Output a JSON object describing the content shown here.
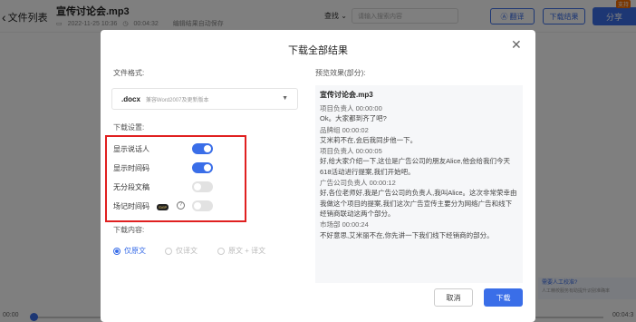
{
  "header": {
    "back_label": "文件列表",
    "file_title": "宣传讨论会.mp3",
    "date": "2022-11-25 10:36",
    "duration": "00:04:32",
    "autosave": "编辑结果自动保存",
    "find_label": "查找",
    "search_placeholder": "请输入搜索内容",
    "translate_label": "翻译",
    "download_result_label": "下载结果",
    "share_label": "分享",
    "share_badge": "支持"
  },
  "player": {
    "time_left": "00:00",
    "time_right": "00:04:3",
    "progress": 0
  },
  "side_tip": {
    "title": "需要人工校准?",
    "sub": "人工精校服务有助提升识别准确率"
  },
  "modal": {
    "title": "下载全部结果",
    "format_label": "文件格式:",
    "format_value": ".docx",
    "format_hint": "兼容Word2007及更新版本",
    "settings_label": "下载设置:",
    "settings": [
      {
        "label": "显示说话人",
        "on": true
      },
      {
        "label": "显示时间码",
        "on": true
      },
      {
        "label": "无分段文稿",
        "on": false
      },
      {
        "label": "场记时间码",
        "on": false
      }
    ],
    "svip_badge": "SVIP",
    "help_icon": "?",
    "content_label": "下载内容:",
    "content_options": [
      {
        "label": "仅原文",
        "checked": true
      },
      {
        "label": "仅译文",
        "checked": false
      },
      {
        "label": "原文 + 译文",
        "checked": false
      }
    ],
    "preview_label": "预览效果(部分):",
    "preview": {
      "title": "宣传讨论会.mp3",
      "lines": [
        {
          "type": "spk",
          "text": "项目负责人  00:00:00"
        },
        {
          "type": "txt",
          "text": "Ok。大家都到齐了吧?"
        },
        {
          "type": "spk",
          "text": "品牌组  00:00:02"
        },
        {
          "type": "txt",
          "text": "艾米莉不在,会后我同步他一下。"
        },
        {
          "type": "spk",
          "text": "项目负责人  00:00:05"
        },
        {
          "type": "txt",
          "text": "好,给大家介绍一下,这位是广告公司的朋友Alice,他会给我们今天618活动进行提案,我们开始吧。"
        },
        {
          "type": "spk",
          "text": "广告公司负责人  00:00:12"
        },
        {
          "type": "txt",
          "text": "好,各位老师好,我是广告公司的负责人,我叫Alice。这次非常荣幸由我做这个项目的提案,我们这次广告宣传主要分为网络广告和线下经销商联动这两个部分。"
        },
        {
          "type": "spk",
          "text": "市场部  00:00:24"
        },
        {
          "type": "txt",
          "text": "不好意思,艾米丽不在,你先讲一下我们线下经销商的部分。"
        }
      ]
    },
    "cancel_label": "取消",
    "confirm_label": "下载"
  }
}
